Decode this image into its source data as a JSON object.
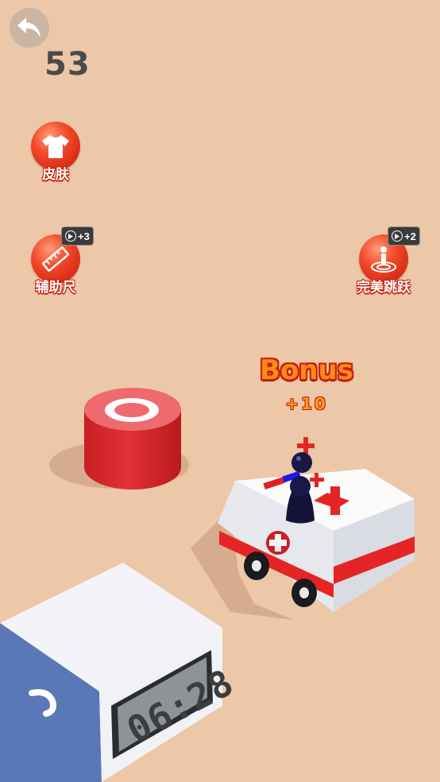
{
  "hud": {
    "score": "53"
  },
  "powerups": [
    {
      "name": "skin",
      "label": "皮肤",
      "icon": "tshirt-icon",
      "badge": ""
    },
    {
      "name": "ruler",
      "label": "辅助尺",
      "icon": "ruler-icon",
      "badge": "+3"
    },
    {
      "name": "perfect-jump",
      "label": "完美跳跃",
      "icon": "jump-target-icon",
      "badge": "+2"
    }
  ],
  "bonus": {
    "title": "Bonus",
    "value": "+10"
  },
  "scene": {
    "clock_display": "06:28",
    "colors": {
      "background": "#ecc7a8",
      "accent_red": "#e23a2c",
      "player": "#15123a"
    }
  }
}
